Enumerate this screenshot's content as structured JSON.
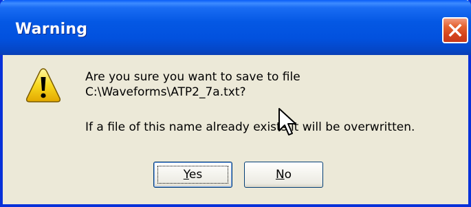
{
  "dialog": {
    "title": "Warning",
    "message_line1": "Are you sure you want to save to file",
    "message_line2": "C:\\Waveforms\\ATP2_7a.txt?",
    "message_line3": "If a file of this name already exists it will be overwritten.",
    "icon": "warning-icon"
  },
  "buttons": {
    "yes_mnemonic": "Y",
    "yes_rest": "es",
    "no_mnemonic": "N",
    "no_rest": "o"
  },
  "colors": {
    "titlebar": "#0458e4",
    "close": "#d4441c",
    "face": "#ece9d8"
  }
}
